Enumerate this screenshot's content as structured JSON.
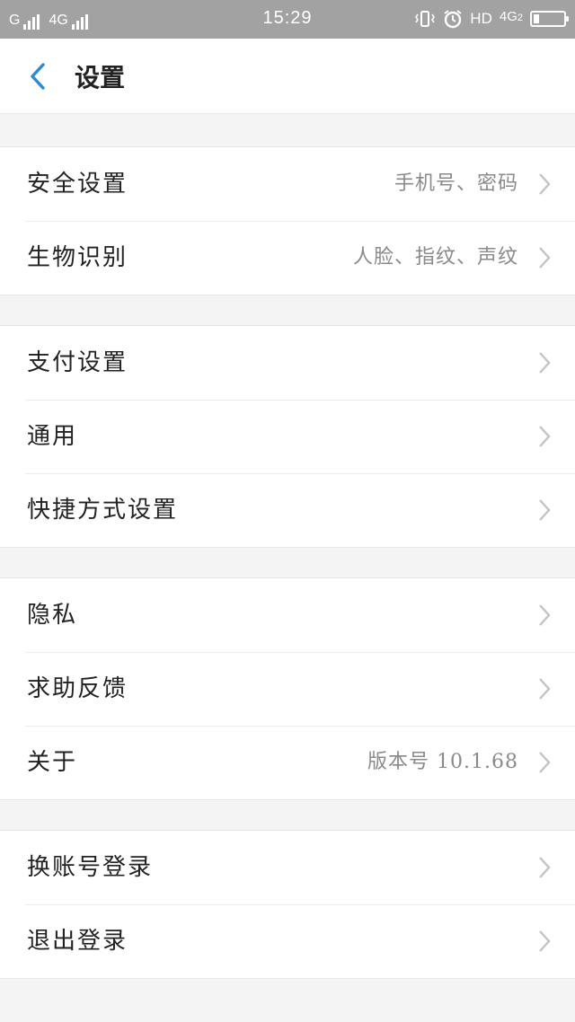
{
  "status_bar": {
    "carrier1": "G",
    "carrier2": "4G",
    "time": "15:29",
    "hd": "HD",
    "network": "4G",
    "network_sub": "2",
    "icons": [
      "signal-bars-icon",
      "vibrate-icon",
      "alarm-icon",
      "battery-icon"
    ]
  },
  "nav": {
    "title": "设置",
    "back_icon": "chevron-left-icon",
    "accent": "#2a8bd4"
  },
  "groups": [
    {
      "rows": [
        {
          "label": "安全设置",
          "value": "手机号、密码"
        },
        {
          "label": "生物识别",
          "value": "人脸、指纹、声纹"
        }
      ]
    },
    {
      "rows": [
        {
          "label": "支付设置",
          "value": ""
        },
        {
          "label": "通用",
          "value": ""
        },
        {
          "label": "快捷方式设置",
          "value": ""
        }
      ]
    },
    {
      "rows": [
        {
          "label": "隐私",
          "value": ""
        },
        {
          "label": "求助反馈",
          "value": ""
        },
        {
          "label": "关于",
          "value": "版本号 10.1.68"
        }
      ]
    },
    {
      "rows": [
        {
          "label": "换账号登录",
          "value": ""
        },
        {
          "label": "退出登录",
          "value": ""
        }
      ]
    }
  ]
}
